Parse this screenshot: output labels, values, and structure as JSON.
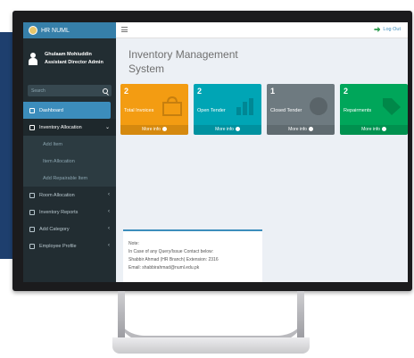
{
  "app": {
    "logo_text": "HR NUML"
  },
  "user": {
    "name": "Ghulaam Mohiuddin",
    "role": "Assistant Director Admin"
  },
  "search": {
    "placeholder": "Search"
  },
  "sidebar": {
    "items": [
      {
        "label": "Dashboard",
        "active": true
      },
      {
        "label": "Inventory Allocation",
        "open": true,
        "children": [
          {
            "label": "Add Item"
          },
          {
            "label": "Item Allocation"
          },
          {
            "label": "Add Repairable Item"
          }
        ]
      },
      {
        "label": "Room Allocation"
      },
      {
        "label": "Inventory Reports"
      },
      {
        "label": "Add Category"
      },
      {
        "label": "Employee Profile"
      }
    ]
  },
  "header": {
    "logout_label": "Log Out"
  },
  "main": {
    "title": "Inventory Management System",
    "boxes": [
      {
        "count": "2",
        "label": "Total Invoices",
        "more": "More info",
        "color": "#f39c12",
        "icon": "shopping-bag-icon"
      },
      {
        "count": "2",
        "label": "Open Tender",
        "more": "More info",
        "color": "#00a5b5",
        "icon": "bar-chart-icon"
      },
      {
        "count": "1",
        "label": "Closed Tender",
        "more": "More info",
        "color": "#6e7a80",
        "icon": "pie-chart-icon"
      },
      {
        "count": "2",
        "label": "Repairments",
        "more": "More info",
        "color": "#00a65a",
        "icon": "tag-icon"
      }
    ],
    "note": {
      "heading": "Note:",
      "line1": "In Case of any Query/Issue Contact below:",
      "line2": "Shabbir Ahmad (HR Branch) Extension: 2316",
      "line3": "Email: shabbirahmad@numl.edu.pk"
    }
  }
}
